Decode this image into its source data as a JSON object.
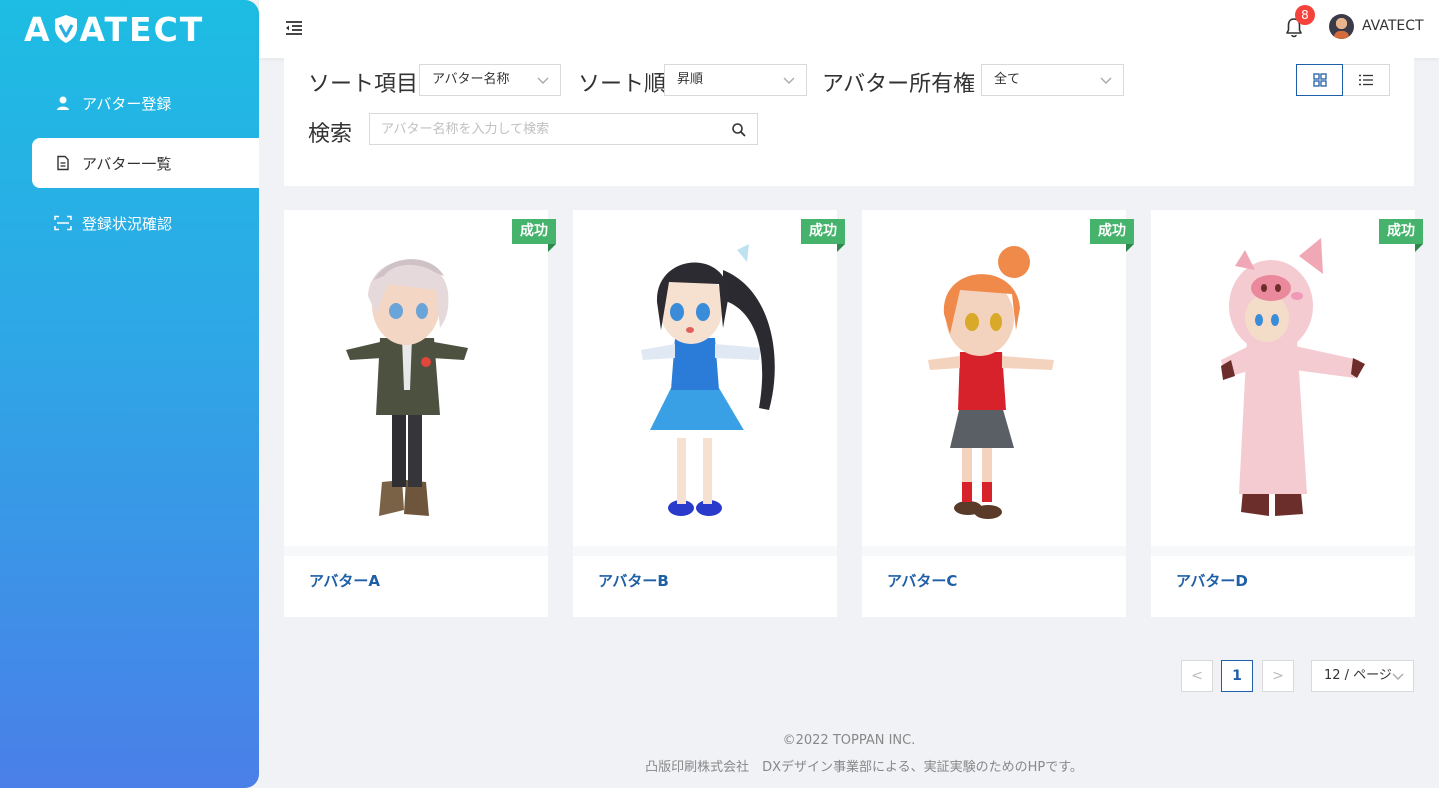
{
  "brand": {
    "logo_left": "A",
    "logo_right": "ATECT"
  },
  "sidebar": {
    "items": [
      {
        "label": "アバター登録",
        "icon": "user-icon",
        "active": false
      },
      {
        "label": "アバター一覧",
        "icon": "document-icon",
        "active": true
      },
      {
        "label": "登録状況確認",
        "icon": "scan-icon",
        "active": false
      }
    ]
  },
  "header": {
    "notification_count": "8",
    "username": "AVATECT"
  },
  "filters": {
    "sort_item_label": "ソート項目",
    "sort_item_value": "アバター名称",
    "sort_order_label": "ソート順",
    "sort_order_value": "昇順",
    "ownership_label": "アバター所有権",
    "ownership_value": "全て",
    "search_label": "検索",
    "search_placeholder": "アバター名称を入力して検索",
    "search_value": ""
  },
  "cards": [
    {
      "name": "アバターA",
      "status": "成功"
    },
    {
      "name": "アバターB",
      "status": "成功"
    },
    {
      "name": "アバターC",
      "status": "成功"
    },
    {
      "name": "アバターD",
      "status": "成功"
    }
  ],
  "pagination": {
    "prev": "<",
    "current_page": "1",
    "next": ">",
    "page_size": "12 / ページ"
  },
  "footer": {
    "copyright": "©2022 TOPPAN INC.",
    "note": "凸版印刷株式会社　DXデザイン事業部による、実証実験のためのHPです。"
  },
  "colors": {
    "accent": "#1f5fa8",
    "success": "#45b36b",
    "badge": "#f5423a",
    "sidebar_top": "#1dbde3",
    "sidebar_bottom": "#4a7fe8"
  }
}
